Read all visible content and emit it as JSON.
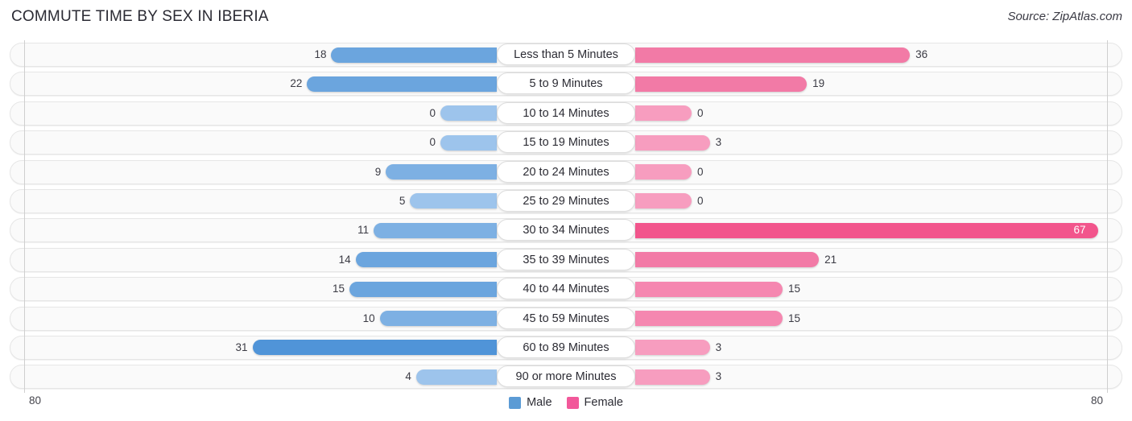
{
  "header": {
    "title": "COMMUTE TIME BY SEX IN IBERIA",
    "source": "Source: ZipAtlas.com"
  },
  "legend": {
    "male_label": "Male",
    "female_label": "Female",
    "male_color": "#5b9bd5",
    "female_color": "#f2589a"
  },
  "axis": {
    "left_tick": "80",
    "right_tick": "80",
    "max": 80
  },
  "chart_data": {
    "type": "bar",
    "orientation": "horizontal-diverging",
    "title": "COMMUTE TIME BY SEX IN IBERIA",
    "xlabel": "",
    "ylabel": "",
    "xlim": [
      80,
      80
    ],
    "grid": false,
    "legend_position": "bottom-center",
    "categories": [
      "Less than 5 Minutes",
      "5 to 9 Minutes",
      "10 to 14 Minutes",
      "15 to 19 Minutes",
      "20 to 24 Minutes",
      "25 to 29 Minutes",
      "30 to 34 Minutes",
      "35 to 39 Minutes",
      "40 to 44 Minutes",
      "45 to 59 Minutes",
      "60 to 89 Minutes",
      "90 or more Minutes"
    ],
    "series": [
      {
        "name": "Male",
        "values": [
          18,
          22,
          0,
          0,
          9,
          5,
          11,
          14,
          15,
          10,
          31,
          4
        ]
      },
      {
        "name": "Female",
        "values": [
          36,
          19,
          0,
          3,
          0,
          0,
          67,
          21,
          15,
          15,
          3,
          3
        ]
      }
    ]
  },
  "rows": [
    {
      "label": "Less than 5 Minutes",
      "male": "18",
      "female": "36",
      "male_v": 18,
      "female_v": 36
    },
    {
      "label": "5 to 9 Minutes",
      "male": "22",
      "female": "19",
      "male_v": 22,
      "female_v": 19
    },
    {
      "label": "10 to 14 Minutes",
      "male": "0",
      "female": "0",
      "male_v": 0,
      "female_v": 0
    },
    {
      "label": "15 to 19 Minutes",
      "male": "0",
      "female": "3",
      "male_v": 0,
      "female_v": 3
    },
    {
      "label": "20 to 24 Minutes",
      "male": "9",
      "female": "0",
      "male_v": 9,
      "female_v": 0
    },
    {
      "label": "25 to 29 Minutes",
      "male": "5",
      "female": "0",
      "male_v": 5,
      "female_v": 0
    },
    {
      "label": "30 to 34 Minutes",
      "male": "11",
      "female": "67",
      "male_v": 11,
      "female_v": 67
    },
    {
      "label": "35 to 39 Minutes",
      "male": "14",
      "female": "21",
      "male_v": 14,
      "female_v": 21
    },
    {
      "label": "40 to 44 Minutes",
      "male": "15",
      "female": "15",
      "male_v": 15,
      "female_v": 15
    },
    {
      "label": "45 to 59 Minutes",
      "male": "10",
      "female": "15",
      "male_v": 10,
      "female_v": 15
    },
    {
      "label": "60 to 89 Minutes",
      "male": "31",
      "female": "3",
      "male_v": 31,
      "female_v": 3
    },
    {
      "label": "90 or more Minutes",
      "male": "4",
      "female": "3",
      "male_v": 4,
      "female_v": 3
    }
  ]
}
